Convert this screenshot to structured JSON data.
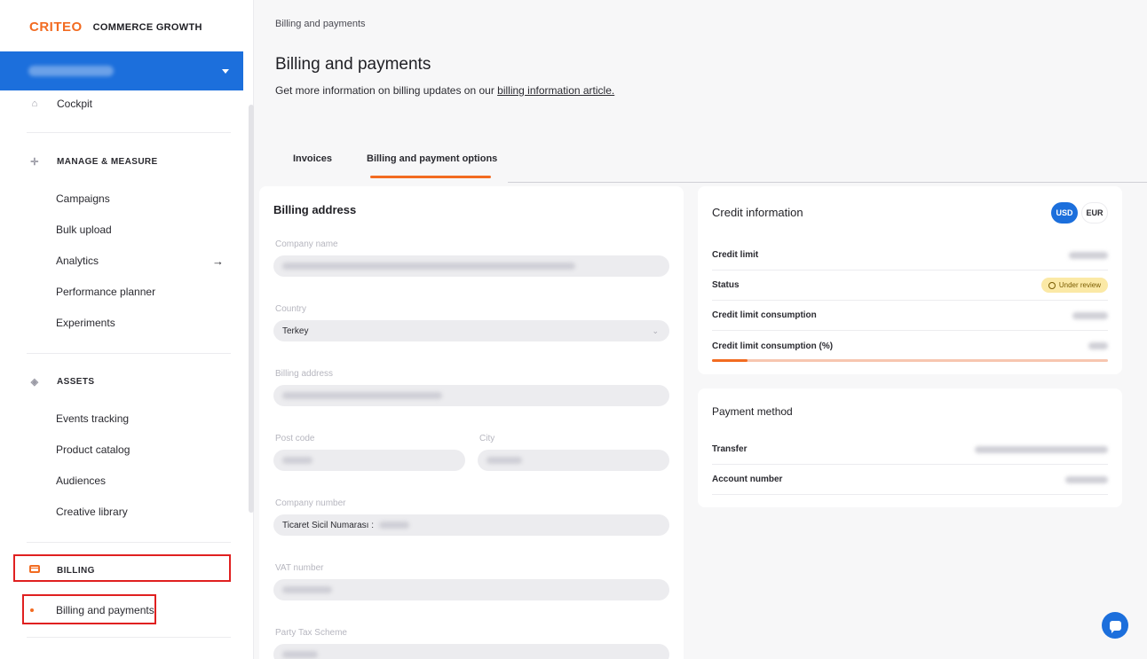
{
  "brand": {
    "logo": "CRITEO",
    "product": "COMMERCE GROWTH",
    "accent": "#f26b21",
    "primary": "#1c6fdc"
  },
  "sidebar": {
    "cockpit": {
      "label": "Cockpit",
      "icon": "home-icon"
    },
    "manage": {
      "heading": "MANAGE & MEASURE",
      "icon": "crosshair-icon",
      "items": [
        {
          "label": "Campaigns"
        },
        {
          "label": "Bulk upload"
        },
        {
          "label": "Analytics",
          "arrow": "→"
        },
        {
          "label": "Performance planner"
        },
        {
          "label": "Experiments"
        }
      ]
    },
    "assets": {
      "heading": "ASSETS",
      "icon": "layers-icon",
      "items": [
        {
          "label": "Events tracking"
        },
        {
          "label": "Product catalog"
        },
        {
          "label": "Audiences"
        },
        {
          "label": "Creative library"
        }
      ]
    },
    "billing": {
      "heading": "BILLING",
      "icon": "credit-card-icon",
      "items": [
        {
          "label": "Billing and payments"
        }
      ]
    }
  },
  "breadcrumb": "Billing and payments",
  "page": {
    "title": "Billing and payments",
    "subtitle_prefix": "Get more information on billing updates on our ",
    "subtitle_link": "billing information article."
  },
  "tabs": [
    {
      "label": "Invoices",
      "active": false
    },
    {
      "label": "Billing and payment options",
      "active": true
    }
  ],
  "billing_address": {
    "title": "Billing address",
    "fields": {
      "company_name": {
        "label": "Company name"
      },
      "country": {
        "label": "Country",
        "value": "Terkey"
      },
      "billing_address": {
        "label": "Billing address"
      },
      "post_code": {
        "label": "Post code"
      },
      "city": {
        "label": "City"
      },
      "company_number": {
        "label": "Company number",
        "value": "Ticaret Sicil Numarası :"
      },
      "vat_number": {
        "label": "VAT number"
      },
      "party_tax_scheme": {
        "label": "Party Tax Scheme"
      }
    }
  },
  "credit": {
    "title": "Credit information",
    "currencies": [
      "USD",
      "EUR"
    ],
    "selected_currency": "USD",
    "rows": {
      "limit": "Credit limit",
      "status": "Status",
      "status_value": "Under review",
      "consumption": "Credit limit consumption",
      "consumption_pct": "Credit limit consumption (%)"
    },
    "consumption_fraction": 0.09
  },
  "payment": {
    "title": "Payment method",
    "rows": {
      "transfer": "Transfer",
      "account": "Account number"
    }
  }
}
